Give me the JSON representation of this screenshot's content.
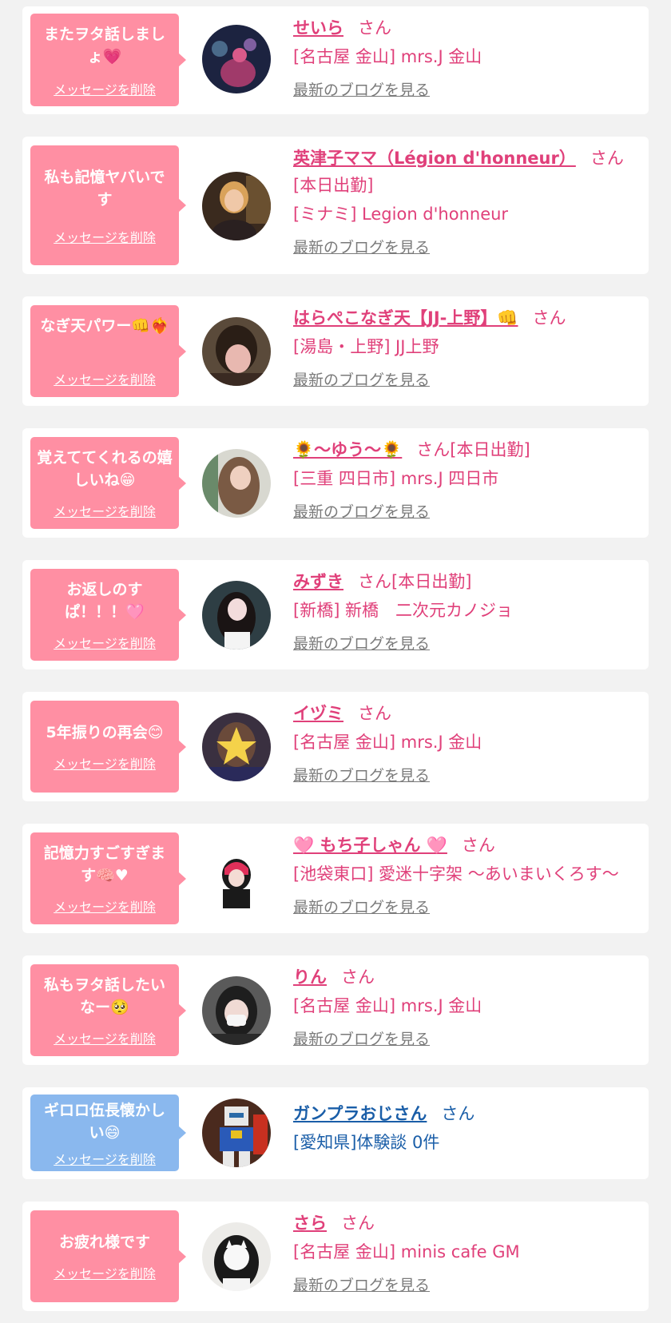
{
  "delete_label": "メッセージを削除",
  "blog_label": "最新のブログを見る",
  "san_label": "さん",
  "cards": [
    {
      "message": "またヲタ話しましょ💗",
      "name": "せいら",
      "suffix": "さん",
      "shop": "[名古屋 金山] mrs.J 金山",
      "avatar": "dark-night-photo"
    },
    {
      "message": "私も記憶ヤバいです",
      "name": "英津子ママ（Légion d'honneur）",
      "suffix": "さん[本日出勤]",
      "shop": "[ミナミ] Legion d'honneur",
      "avatar": "blonde-woman-photo"
    },
    {
      "message": "なぎ天パワー👊❤️‍🔥",
      "name": "はらぺこなぎ天【JJ-上野】👊",
      "suffix": "さん",
      "shop": "[湯島・上野] JJ上野",
      "avatar": "blurred-face-photo"
    },
    {
      "message": "覚えててくれるの嬉しいね😁",
      "name": "🌻〜ゆう〜🌻",
      "suffix": "さん[本日出勤]",
      "shop": "[三重 四日市] mrs.J 四日市",
      "avatar": "wavy-hair-photo"
    },
    {
      "message": "お返しのすぱ！！！🩷",
      "name": "みずき",
      "suffix": "さん[本日出勤]",
      "shop": "[新橋] 新橋　二次元カノジョ",
      "avatar": "masked-girl-photo"
    },
    {
      "message": "5年振りの再会😊",
      "name": "イヅミ",
      "suffix": "さん",
      "shop": "[名古屋 金山] mrs.J 金山",
      "avatar": "star-face-photo"
    },
    {
      "message": "記憶力すごすぎます🧠♥",
      "name": "🩷 もち子しゃん 🩷",
      "suffix": "さん",
      "shop": "[池袋東口] 愛迷十字架 〜あいまいくろす〜",
      "avatar": "pink-hair-girl-photo"
    },
    {
      "message": "私もヲタ話したいなー🥺",
      "name": "りん",
      "suffix": "さん",
      "shop": "[名古屋 金山] mrs.J 金山",
      "avatar": "mask-girl-photo"
    },
    {
      "message": "ギロロ伍長懐かしい😄",
      "name": "ガンプラおじさん",
      "suffix": "さん",
      "shop": "[愛知県]体験談 0件",
      "avatar": "gundam-model-photo",
      "male": true
    },
    {
      "message": "お疲れ様です",
      "name": "さら",
      "suffix": "さん",
      "shop": "[名古屋 金山] minis cafe GM",
      "avatar": "cat-mask-girl-photo"
    }
  ]
}
